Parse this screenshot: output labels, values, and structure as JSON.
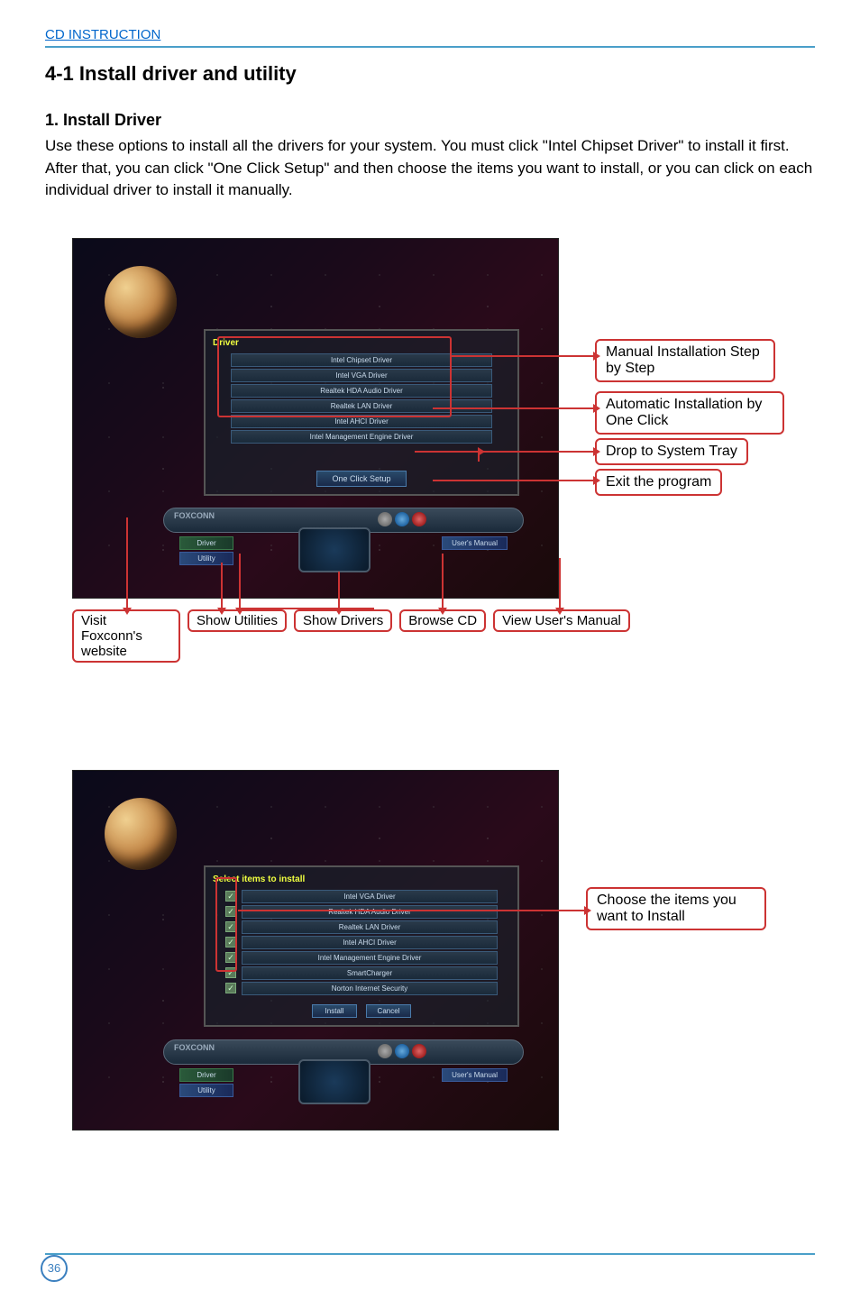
{
  "header": {
    "link": "CD INSTRUCTION"
  },
  "section": {
    "title": "4-1 Install driver and utility",
    "subtitle": "1. Install Driver",
    "body": "Use these options to install all the drivers for your system. You must click \"Intel Chipset Driver\" to install it first. After that, you can click \"One Click Setup\" and then choose the items you want to install, or you can click on each individual driver to install it manually."
  },
  "screenshot1": {
    "panel_title": "Driver",
    "drivers": [
      "Intel  Chipset  Driver",
      "Intel VGA  Driver",
      "Realtek HDA  Audio Driver",
      "Realtek LAN Driver",
      "Intel AHCI  Driver",
      "Intel  Management Engine  Driver"
    ],
    "one_click": "One Click Setup",
    "brand": "FOXCONN",
    "left_buttons": [
      "Driver",
      "Utility"
    ],
    "right_buttons": [
      "User's Manual"
    ]
  },
  "callouts1": {
    "right": [
      "Manual Installation Step by Step",
      "Automatic Installation  by One Click",
      "Drop to System Tray",
      "Exit the program"
    ],
    "bottom": [
      "Visit Foxconn's website",
      "Show Utilities",
      "Show Drivers",
      "Browse CD",
      "View User's Manual"
    ]
  },
  "screenshot2": {
    "panel_title": "Select items to install",
    "items": [
      "Intel VGA  Driver",
      "Realtek HDA  Audio Driver",
      "Realtek LAN Driver",
      "Intel AHCI  Driver",
      "Intel  Management Engine  Driver",
      "SmartCharger",
      "Norton  Internet Security"
    ],
    "install": "Install",
    "cancel": "Cancel",
    "brand": "FOXCONN",
    "left_buttons": [
      "Driver",
      "Utility"
    ],
    "right_buttons": [
      "User's Manual"
    ]
  },
  "callouts2": {
    "right": "Choose the items you want to Install"
  },
  "page": {
    "number": "36"
  }
}
